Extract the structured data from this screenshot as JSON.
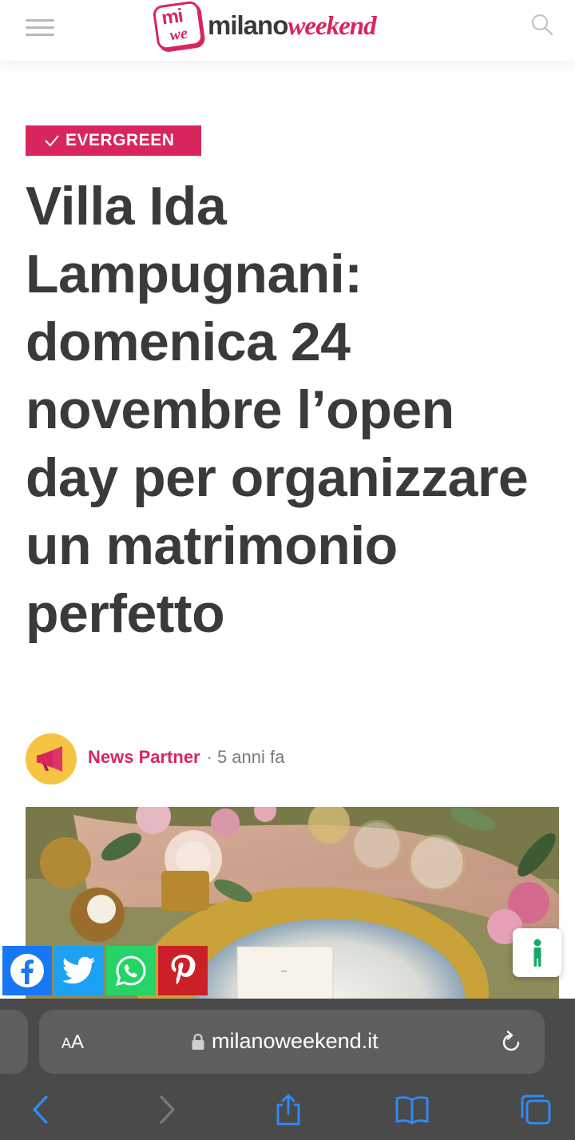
{
  "header": {
    "logo": {
      "badge_top": "mi",
      "badge_bottom": "we",
      "word_main": "milano",
      "word_accent": "weekend"
    },
    "brand_color": "#d8265d"
  },
  "article": {
    "category": "EVERGREEN",
    "title": "Villa Ida Lampugnani: domenica 24 novembre l’open day per organizzare un matrimonio perfetto",
    "author": "News Partner",
    "separator": "·",
    "published": "5 anni fa"
  },
  "share": {
    "buttons": [
      {
        "name": "facebook",
        "color": "#1877f2"
      },
      {
        "name": "twitter",
        "color": "#1da1f2"
      },
      {
        "name": "whatsapp",
        "color": "#25d366"
      },
      {
        "name": "pinterest",
        "color": "#cb2027"
      }
    ]
  },
  "browser": {
    "aa_small": "A",
    "aa_big": "A",
    "url": "milanoweekend.it",
    "accent": "#2f8cff"
  }
}
